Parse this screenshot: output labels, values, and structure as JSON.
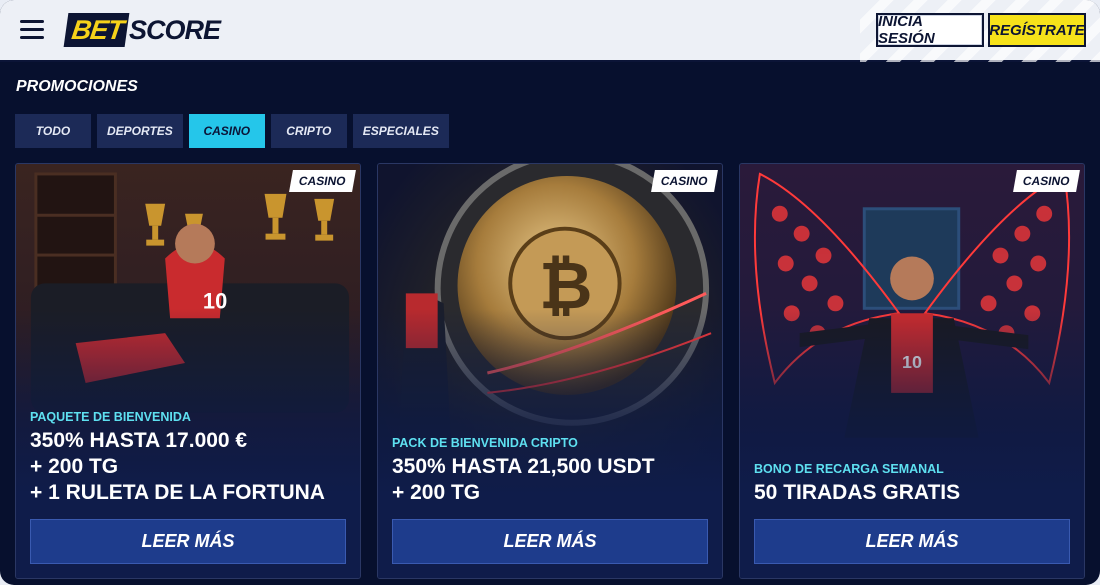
{
  "header": {
    "logo_left": "BET",
    "logo_right": "SCORE",
    "login_label": "INICIA SESIÓN",
    "register_label": "REGÍSTRATE"
  },
  "page_title": "PROMOCIONES",
  "tabs": [
    {
      "label": "TODO",
      "active": false
    },
    {
      "label": "DEPORTES",
      "active": false
    },
    {
      "label": "CASINO",
      "active": true
    },
    {
      "label": "CRIPTO",
      "active": false
    },
    {
      "label": "ESPECIALES",
      "active": false
    }
  ],
  "cards": [
    {
      "badge": "CASINO",
      "kicker": "PAQUETE DE BIENVENIDA",
      "lines": [
        "350% HASTA 17.000 €",
        "+ 200 TG",
        "+ 1 RULETA DE LA FORTUNA"
      ],
      "button": "LEER MÁS"
    },
    {
      "badge": "CASINO",
      "kicker": "PACK DE BIENVENIDA CRIPTO",
      "lines": [
        "350% HASTA 21,500 USDT",
        "+ 200 TG"
      ],
      "button": "LEER MÁS"
    },
    {
      "badge": "CASINO",
      "kicker": "BONO DE RECARGA SEMANAL",
      "lines": [
        "50 TIRADAS GRATIS"
      ],
      "button": "LEER MÁS"
    }
  ],
  "colors": {
    "background": "#07102e",
    "accent_tab": "#25c6ea",
    "register_yellow": "#f6e21a",
    "kicker_cyan": "#5ee0f0",
    "button_blue": "#1e3c8c"
  },
  "icons": {
    "menu": "hamburger-menu-icon"
  }
}
